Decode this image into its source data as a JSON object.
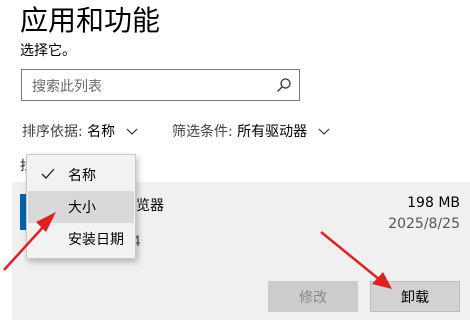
{
  "page": {
    "title": "应用和功能",
    "subtitle": "选择它。"
  },
  "search": {
    "placeholder": "搜索此列表"
  },
  "filters": {
    "sort": {
      "label": "排序依据:",
      "value": "名称"
    },
    "drive": {
      "label": "筛选条件:",
      "value": "所有驱动器"
    }
  },
  "count_label_fragment": "找",
  "menu": {
    "items": [
      {
        "label": "名称",
        "checked": true
      },
      {
        "label": "大小",
        "checked": false,
        "highlighted": true
      },
      {
        "label": "安装日期",
        "checked": false
      }
    ]
  },
  "app": {
    "name_fragment": "览器",
    "version_fragment": "4",
    "size": "198 MB",
    "date": "2025/8/25",
    "accent_color": "#0063b1"
  },
  "buttons": {
    "modify": "修改",
    "uninstall": "卸载"
  },
  "annotation_color": "#e02020"
}
